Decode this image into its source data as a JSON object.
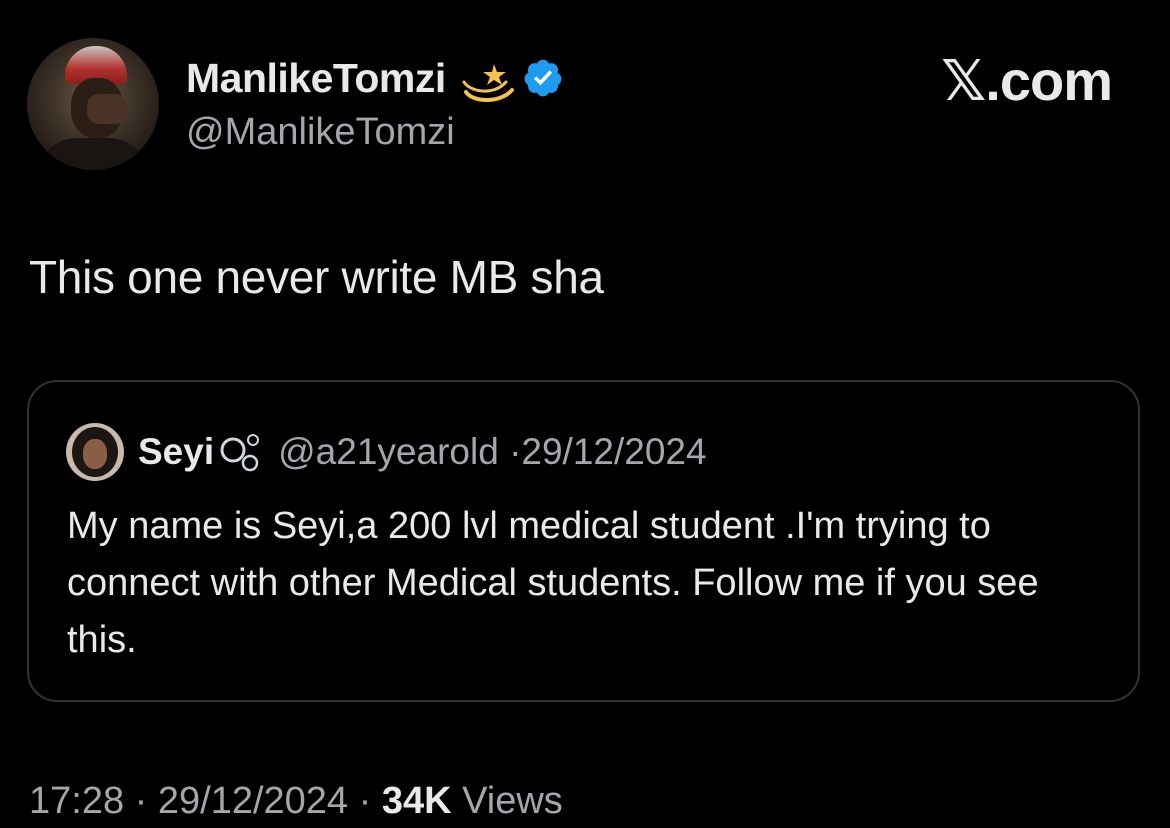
{
  "author": {
    "display_name": "ManlikeTomzi",
    "handle": "@ManlikeTomzi",
    "emoji": "dizzy-star-icon",
    "verified": true
  },
  "brand": "𝕏.com",
  "tweet": {
    "text": "This one never write MB sha"
  },
  "quoted_tweet": {
    "display_name": "Seyi",
    "emoji": "bubbles-icon",
    "handle": "@a21yearold",
    "separator": "·",
    "date": "29/12/2024",
    "text": "My name is Seyi,a 200 lvl medical student .I'm trying to connect with other Medical students. Follow me if you see this."
  },
  "footer": {
    "time": "17:28",
    "separator": "·",
    "date": "29/12/2024",
    "views_count": "34K",
    "views_label": "Views"
  },
  "colors": {
    "background": "#000000",
    "text_primary": "#e7e9ea",
    "text_secondary": "#a3a7ab",
    "verified_blue": "#1d9bf0",
    "card_border": "#2f3336"
  }
}
